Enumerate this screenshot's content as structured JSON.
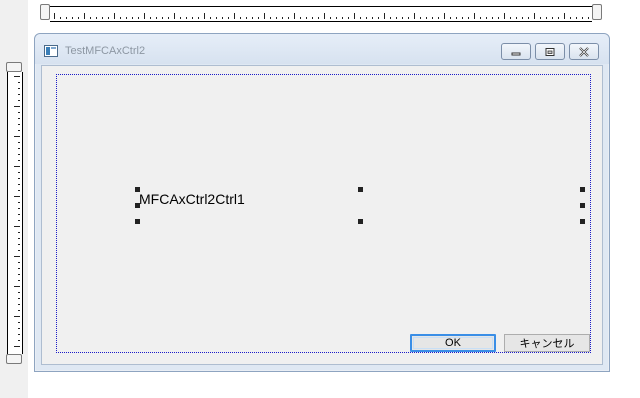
{
  "window": {
    "title": "TestMFCAxCtrl2",
    "minimize_icon": "minimize-icon",
    "maximize_icon": "maximize-icon",
    "close_icon": "close-icon"
  },
  "dialog": {
    "control_label": "MFCAxCtrl2Ctrl1",
    "ok_label": "OK",
    "cancel_label": "キャンセル"
  },
  "colors": {
    "dotted_frame": "#1c1cc8",
    "default_button_border": "#3a8ee6"
  }
}
